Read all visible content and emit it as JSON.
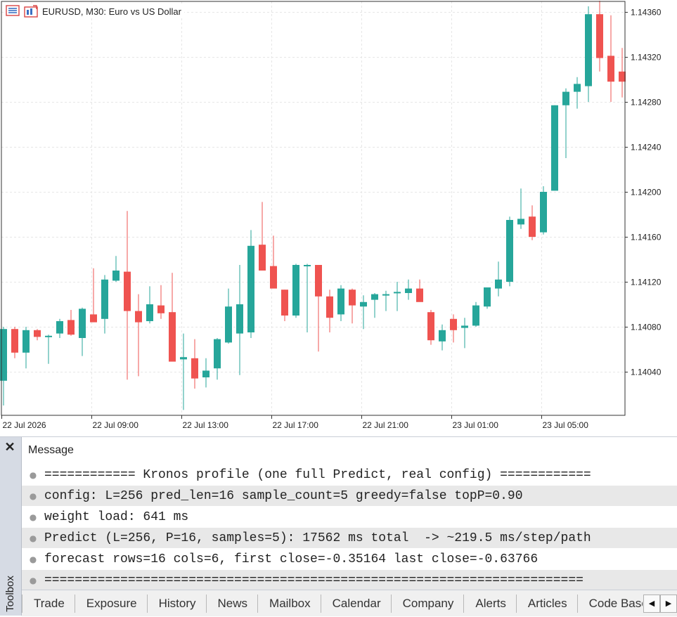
{
  "chart": {
    "symbol_title": "EURUSD, M30:  Euro vs US Dollar",
    "icons": [
      "market-watch-icon",
      "chart-template-icon"
    ],
    "colors": {
      "bull": "#26a69a",
      "bear": "#ef5350",
      "grid": "#e6e6e6",
      "axis": "#333333"
    }
  },
  "chart_data": {
    "type": "candlestick",
    "symbol": "EURUSD",
    "timeframe": "M30",
    "ylim": [
      1.14,
      1.1437
    ],
    "y_ticks": [
      "1.14360",
      "1.14320",
      "1.14280",
      "1.14240",
      "1.14200",
      "1.14160",
      "1.14120",
      "1.14080",
      "1.14040"
    ],
    "x_ticks": [
      "22 Jul 2026",
      "22 Jul 09:00",
      "22 Jul 13:00",
      "22 Jul 17:00",
      "22 Jul 21:00",
      "23 Jul 01:00",
      "23 Jul 05:00"
    ],
    "candles": [
      {
        "o": 1.14032,
        "h": 1.1408,
        "l": 1.1401,
        "c": 1.14078
      },
      {
        "o": 1.14078,
        "h": 1.1408,
        "l": 1.14052,
        "c": 1.14057
      },
      {
        "o": 1.14057,
        "h": 1.1408,
        "l": 1.14043,
        "c": 1.14077
      },
      {
        "o": 1.14077,
        "h": 1.14078,
        "l": 1.14068,
        "c": 1.14071
      },
      {
        "o": 1.14072,
        "h": 1.14073,
        "l": 1.14047,
        "c": 1.14072
      },
      {
        "o": 1.14074,
        "h": 1.14087,
        "l": 1.1407,
        "c": 1.14085
      },
      {
        "o": 1.14086,
        "h": 1.14095,
        "l": 1.14072,
        "c": 1.14073
      },
      {
        "o": 1.1407,
        "h": 1.14097,
        "l": 1.14054,
        "c": 1.14096
      },
      {
        "o": 1.14091,
        "h": 1.14132,
        "l": 1.14086,
        "c": 1.14084
      },
      {
        "o": 1.14087,
        "h": 1.14126,
        "l": 1.14074,
        "c": 1.14122
      },
      {
        "o": 1.14121,
        "h": 1.14143,
        "l": 1.1412,
        "c": 1.1413
      },
      {
        "o": 1.14129,
        "h": 1.14183,
        "l": 1.14033,
        "c": 1.14094
      },
      {
        "o": 1.14094,
        "h": 1.14109,
        "l": 1.14036,
        "c": 1.14084
      },
      {
        "o": 1.14085,
        "h": 1.14116,
        "l": 1.14083,
        "c": 1.141
      },
      {
        "o": 1.14099,
        "h": 1.14117,
        "l": 1.14087,
        "c": 1.14092
      },
      {
        "o": 1.14093,
        "h": 1.14128,
        "l": 1.14058,
        "c": 1.14049
      },
      {
        "o": 1.14051,
        "h": 1.14074,
        "l": 1.14006,
        "c": 1.14053
      },
      {
        "o": 1.14052,
        "h": 1.14069,
        "l": 1.14025,
        "c": 1.14034
      },
      {
        "o": 1.14035,
        "h": 1.14052,
        "l": 1.14026,
        "c": 1.14041
      },
      {
        "o": 1.14043,
        "h": 1.1407,
        "l": 1.14033,
        "c": 1.14069
      },
      {
        "o": 1.14066,
        "h": 1.14114,
        "l": 1.14065,
        "c": 1.14098
      },
      {
        "o": 1.14074,
        "h": 1.14135,
        "l": 1.14037,
        "c": 1.141
      },
      {
        "o": 1.14075,
        "h": 1.14166,
        "l": 1.1407,
        "c": 1.14152
      },
      {
        "o": 1.14153,
        "h": 1.14191,
        "l": 1.14135,
        "c": 1.1413
      },
      {
        "o": 1.14134,
        "h": 1.14161,
        "l": 1.14116,
        "c": 1.14114
      },
      {
        "o": 1.14113,
        "h": 1.14113,
        "l": 1.14085,
        "c": 1.1409
      },
      {
        "o": 1.1409,
        "h": 1.14136,
        "l": 1.14088,
        "c": 1.14135
      },
      {
        "o": 1.14135,
        "h": 1.14136,
        "l": 1.14075,
        "c": 1.14135
      },
      {
        "o": 1.14135,
        "h": 1.14135,
        "l": 1.14058,
        "c": 1.14107
      },
      {
        "o": 1.14107,
        "h": 1.14113,
        "l": 1.14075,
        "c": 1.14088
      },
      {
        "o": 1.14091,
        "h": 1.14117,
        "l": 1.14085,
        "c": 1.14114
      },
      {
        "o": 1.14113,
        "h": 1.14114,
        "l": 1.14083,
        "c": 1.14099
      },
      {
        "o": 1.14098,
        "h": 1.14108,
        "l": 1.14078,
        "c": 1.14102
      },
      {
        "o": 1.14104,
        "h": 1.1411,
        "l": 1.14088,
        "c": 1.14109
      },
      {
        "o": 1.14108,
        "h": 1.14112,
        "l": 1.14094,
        "c": 1.14109
      },
      {
        "o": 1.1411,
        "h": 1.1412,
        "l": 1.14094,
        "c": 1.14111
      },
      {
        "o": 1.1411,
        "h": 1.14122,
        "l": 1.14104,
        "c": 1.14114
      },
      {
        "o": 1.14114,
        "h": 1.14122,
        "l": 1.1411,
        "c": 1.14102
      },
      {
        "o": 1.14093,
        "h": 1.14095,
        "l": 1.14064,
        "c": 1.14068
      },
      {
        "o": 1.14067,
        "h": 1.14082,
        "l": 1.14059,
        "c": 1.14077
      },
      {
        "o": 1.14087,
        "h": 1.14091,
        "l": 1.14066,
        "c": 1.14077
      },
      {
        "o": 1.14079,
        "h": 1.14088,
        "l": 1.14061,
        "c": 1.14081
      },
      {
        "o": 1.14081,
        "h": 1.14102,
        "l": 1.1408,
        "c": 1.14099
      },
      {
        "o": 1.14098,
        "h": 1.14115,
        "l": 1.14096,
        "c": 1.14115
      },
      {
        "o": 1.14114,
        "h": 1.14138,
        "l": 1.14107,
        "c": 1.14122
      },
      {
        "o": 1.1412,
        "h": 1.14178,
        "l": 1.14116,
        "c": 1.14175
      },
      {
        "o": 1.14171,
        "h": 1.14203,
        "l": 1.14167,
        "c": 1.14176
      },
      {
        "o": 1.14178,
        "h": 1.14188,
        "l": 1.14157,
        "c": 1.1416
      },
      {
        "o": 1.14164,
        "h": 1.14205,
        "l": 1.14162,
        "c": 1.142
      },
      {
        "o": 1.14201,
        "h": 1.14277,
        "l": 1.14201,
        "c": 1.14277
      },
      {
        "o": 1.14277,
        "h": 1.14292,
        "l": 1.1423,
        "c": 1.14289
      },
      {
        "o": 1.14289,
        "h": 1.14302,
        "l": 1.14274,
        "c": 1.14296
      },
      {
        "o": 1.14294,
        "h": 1.14365,
        "l": 1.1428,
        "c": 1.14358
      },
      {
        "o": 1.14358,
        "h": 1.1437,
        "l": 1.14307,
        "c": 1.14319
      },
      {
        "o": 1.14321,
        "h": 1.14357,
        "l": 1.1428,
        "c": 1.14298
      },
      {
        "o": 1.14307,
        "h": 1.14328,
        "l": 1.14284,
        "c": 1.14298
      }
    ]
  },
  "toolbox": {
    "label": "Toolbox",
    "close_glyph": "✕",
    "journal": {
      "header": "Message",
      "rows": [
        "============ Kronos profile (one full Predict, real config) ============",
        "config: L=256 pred_len=16 sample_count=5 greedy=false topP=0.90",
        "weight load: 641 ms",
        "Predict (L=256, P=16, samples=5): 17562 ms total  -> ~219.5 ms/step/path",
        "forecast rows=16 cols=6, first close=-0.35164 last close=-0.63766",
        "======================================================================="
      ]
    },
    "tabs": [
      "Trade",
      "Exposure",
      "History",
      "News",
      "Mailbox",
      "Calendar",
      "Company",
      "Alerts",
      "Articles",
      "Code Base"
    ],
    "scroll_left": "◀",
    "scroll_right": "▶"
  }
}
